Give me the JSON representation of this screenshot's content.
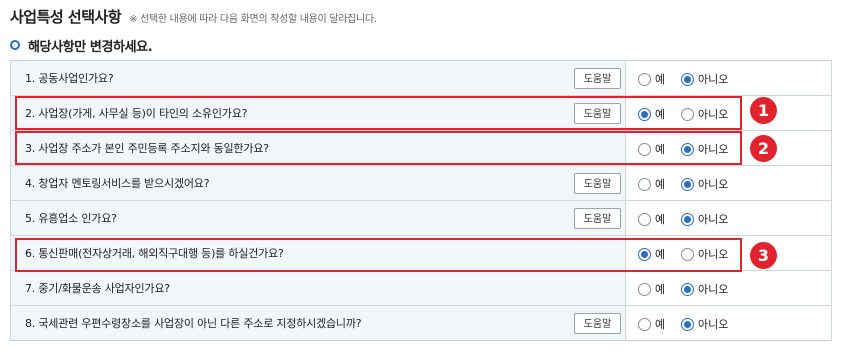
{
  "header": {
    "title": "사업특성 선택사항",
    "note": "※ 선택한 내용에 따라 다음 화면의 작성할 내용이 달라집니다."
  },
  "section": {
    "subtitle": "해당사항만 변경하세요."
  },
  "labels": {
    "yes": "예",
    "no": "아니오",
    "help": "도움말"
  },
  "questions": [
    {
      "text": "1. 공동사업인가요?",
      "help": true,
      "selected": "no"
    },
    {
      "text": "2. 사업장(가게, 사무실 등)이 타인의 소유인가요?",
      "help": true,
      "selected": "yes"
    },
    {
      "text": "3. 사업장 주소가 본인 주민등록 주소지와 동일한가요?",
      "help": false,
      "selected": "no"
    },
    {
      "text": "4. 창업자 멘토링서비스를 받으시겠어요?",
      "help": true,
      "selected": "no"
    },
    {
      "text": "5. 유흥업소 인가요?",
      "help": true,
      "selected": "no"
    },
    {
      "text": "6. 통신판매(전자상거래, 해외직구대행 등)를 하실건가요?",
      "help": false,
      "selected": "yes"
    },
    {
      "text": "7. 중기/화물운송 사업자인가요?",
      "help": false,
      "selected": "no"
    },
    {
      "text": "8. 국세관련 우편수령장소를 사업장이 아닌 다른 주소로 지정하시겠습니까?",
      "help": true,
      "selected": "no"
    }
  ],
  "annotations": [
    "1",
    "2",
    "3"
  ],
  "colors": {
    "accent": "#2a6ec8",
    "highlight": "#e0232c",
    "question_bg": "#f1f6f9"
  }
}
